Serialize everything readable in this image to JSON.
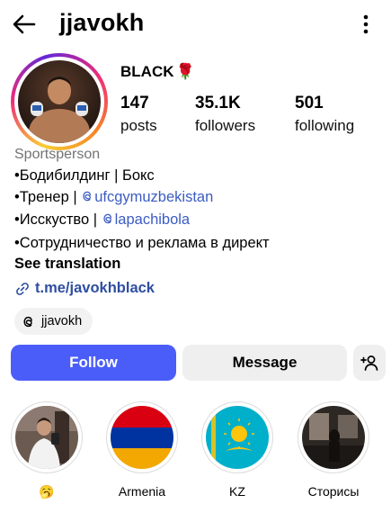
{
  "header": {
    "username": "jjavokh",
    "back_icon": "arrow-left-icon",
    "more_icon": "more-vertical-icon"
  },
  "profile": {
    "display_name": "BLACK",
    "name_emoji": "🌹",
    "avatar_icon": "profile-avatar",
    "stats": [
      {
        "value": "147",
        "label": "posts"
      },
      {
        "value": "35.1K",
        "label": "followers"
      },
      {
        "value": "501",
        "label": "following"
      }
    ]
  },
  "bio": {
    "category": "Sportsperson",
    "line1": "•Бодибилдинг | Бокс",
    "line2_prefix": "•Тренер | ",
    "line2_mention": "ufcgymuzbekistan",
    "line3_prefix": "•Исскуство | ",
    "line3_mention": "lapachibola",
    "line4": "•Сотрудничество и реклама в директ",
    "see_translation": "See translation",
    "link": "t.me/javokhblack"
  },
  "threads": {
    "handle": "jjavokh",
    "icon": "threads-icon"
  },
  "actions": {
    "follow": "Follow",
    "message": "Message",
    "add_user_icon": "add-user-icon"
  },
  "highlights": [
    {
      "label": "🥱"
    },
    {
      "label": "Armenia"
    },
    {
      "label": "KZ"
    },
    {
      "label": "Сторисы"
    }
  ],
  "colors": {
    "follow_blue": "#4a5df9",
    "mention_blue": "#3b5cc2",
    "link_blue": "#2e4ea0",
    "secondary_text": "#737373",
    "button_gray": "#efefef"
  }
}
